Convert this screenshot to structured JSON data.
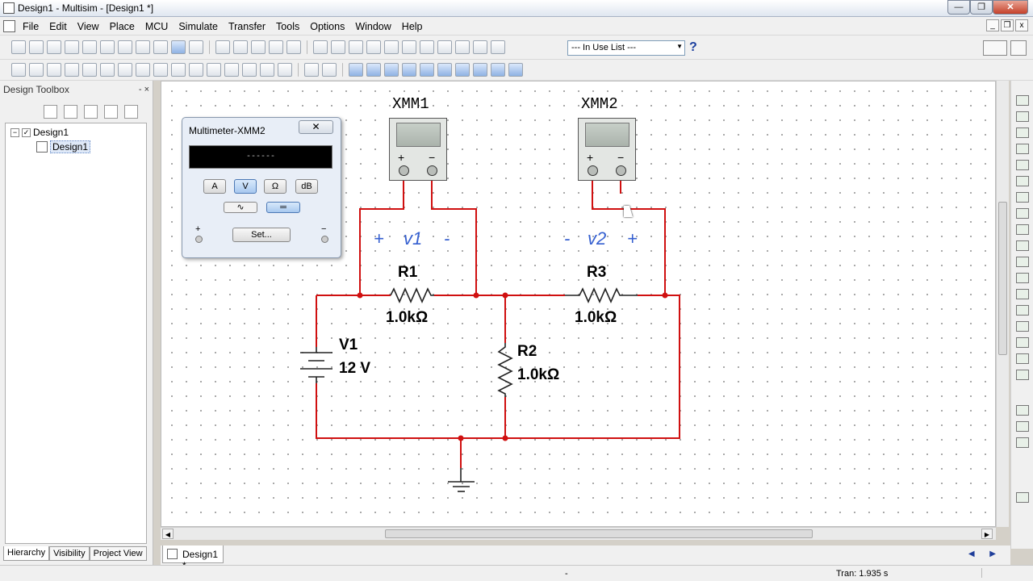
{
  "window": {
    "title": "Design1 - Multisim - [Design1 *]",
    "controls": [
      "—",
      "❐",
      "✕"
    ]
  },
  "menus": [
    "File",
    "Edit",
    "View",
    "Place",
    "MCU",
    "Simulate",
    "Transfer",
    "Tools",
    "Options",
    "Window",
    "Help"
  ],
  "toolbar": {
    "in_use_list": "--- In Use List ---",
    "help_symbol": "?"
  },
  "toolbox": {
    "title": "Design Toolbox",
    "controls": "- ×",
    "tree": [
      {
        "label": "Design1",
        "expander": "−",
        "check": "✓"
      },
      {
        "label": "Design1"
      }
    ],
    "tabs": [
      "Hierarchy",
      "Visibility",
      "Project View"
    ]
  },
  "schematic": {
    "instruments": [
      {
        "ref": "XMM1"
      },
      {
        "ref": "XMM2"
      }
    ],
    "components": {
      "r1": {
        "ref": "R1",
        "value": "1.0kΩ"
      },
      "r2": {
        "ref": "R2",
        "value": "1.0kΩ"
      },
      "r3": {
        "ref": "R3",
        "value": "1.0kΩ"
      },
      "v1": {
        "ref": "V1",
        "value": "12 V"
      }
    },
    "annotations": {
      "v1_plus": "+",
      "v1_label": "v1",
      "v1_minus": "-",
      "v2_minus": "-",
      "v2_label": "v2",
      "v2_plus": "+"
    },
    "terminal_plus": "+",
    "terminal_minus": "−",
    "wire_color": "#d01010"
  },
  "multimeter": {
    "title": "Multimeter-XMM2",
    "close_symbol": "✕",
    "display": "------",
    "modes": [
      "A",
      "V",
      "Ω",
      "dB"
    ],
    "active_mode": "V",
    "waves": [
      "∿",
      "═"
    ],
    "active_wave": "DC",
    "set_label": "Set...",
    "plus": "+",
    "minus": "−"
  },
  "document_tab": {
    "label": "Design1 *"
  },
  "tab_arrows": "◀ ▶",
  "status": {
    "center": "-",
    "tran": "Tran: 1.935 s"
  }
}
